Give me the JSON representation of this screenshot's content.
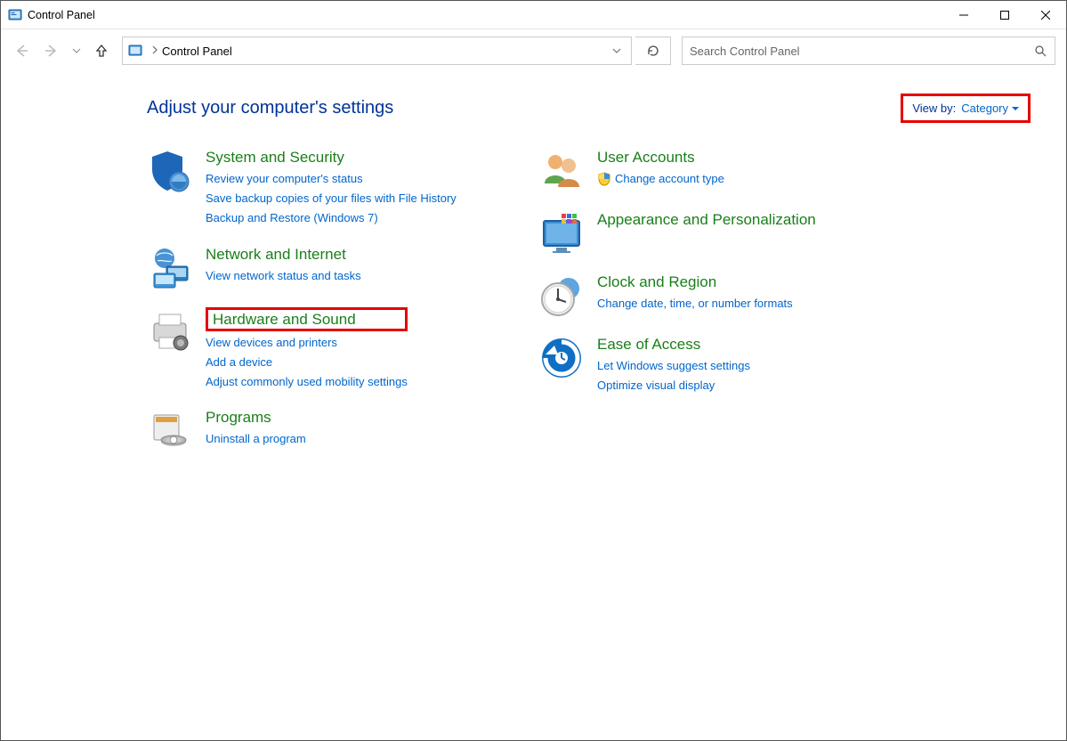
{
  "window": {
    "title": "Control Panel"
  },
  "address": {
    "crumb": "Control Panel"
  },
  "search": {
    "placeholder": "Search Control Panel"
  },
  "heading": "Adjust your computer's settings",
  "viewby": {
    "label": "View by:",
    "value": "Category"
  },
  "left": {
    "system_security": {
      "title": "System and Security",
      "links": [
        "Review your computer's status",
        "Save backup copies of your files with File History",
        "Backup and Restore (Windows 7)"
      ]
    },
    "network": {
      "title": "Network and Internet",
      "links": [
        "View network status and tasks"
      ]
    },
    "hardware": {
      "title": "Hardware and Sound",
      "links": [
        "View devices and printers",
        "Add a device",
        "Adjust commonly used mobility settings"
      ]
    },
    "programs": {
      "title": "Programs",
      "links": [
        "Uninstall a program"
      ]
    }
  },
  "right": {
    "users": {
      "title": "User Accounts",
      "links": [
        "Change account type"
      ]
    },
    "appearance": {
      "title": "Appearance and Personalization"
    },
    "clock": {
      "title": "Clock and Region",
      "links": [
        "Change date, time, or number formats"
      ]
    },
    "ease": {
      "title": "Ease of Access",
      "links": [
        "Let Windows suggest settings",
        "Optimize visual display"
      ]
    }
  },
  "highlights": {
    "hardware_title": true,
    "viewby": true
  }
}
